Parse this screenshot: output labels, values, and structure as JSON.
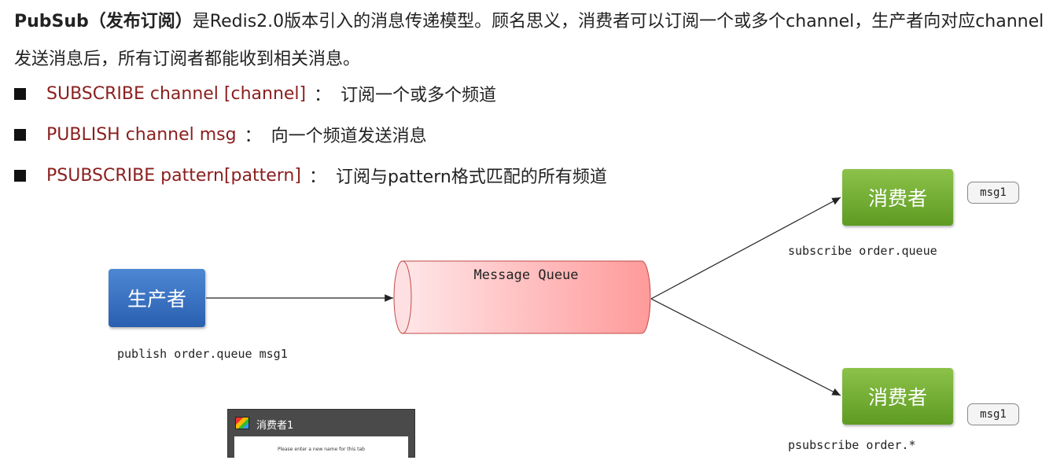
{
  "intro": {
    "bold": "PubSub（发布订阅）",
    "text": "是Redis2.0版本引入的消息传递模型。顾名思义，消费者可以订阅一个或多个channel，生产者向对应channel发送消息后，所有订阅者都能收到相关消息。"
  },
  "commands": [
    {
      "cmd": "SUBSCRIBE channel [channel]",
      "sep": "：",
      "desc": "订阅一个或多个频道"
    },
    {
      "cmd": "PUBLISH channel msg",
      "sep": "：",
      "desc": "向一个频道发送消息"
    },
    {
      "cmd": "PSUBSCRIBE pattern[pattern]",
      "sep": "：",
      "desc": "订阅与pattern格式匹配的所有频道"
    }
  ],
  "diagram": {
    "producer": "生产者",
    "producer_caption": "publish order.queue msg1",
    "queue": "Message Queue",
    "consumers": [
      {
        "label": "消费者",
        "caption": "subscribe order.queue",
        "badge": "msg1"
      },
      {
        "label": "消费者",
        "caption": "psubscribe order.*",
        "badge": "msg1"
      }
    ]
  },
  "popup": {
    "title": "消费者1",
    "text": "Please enter a new name for this tab"
  },
  "colors": {
    "command": "#8b1e1e",
    "producer": "#3a72c4",
    "consumer": "#76ad35",
    "queue": "#ff9a9a"
  }
}
